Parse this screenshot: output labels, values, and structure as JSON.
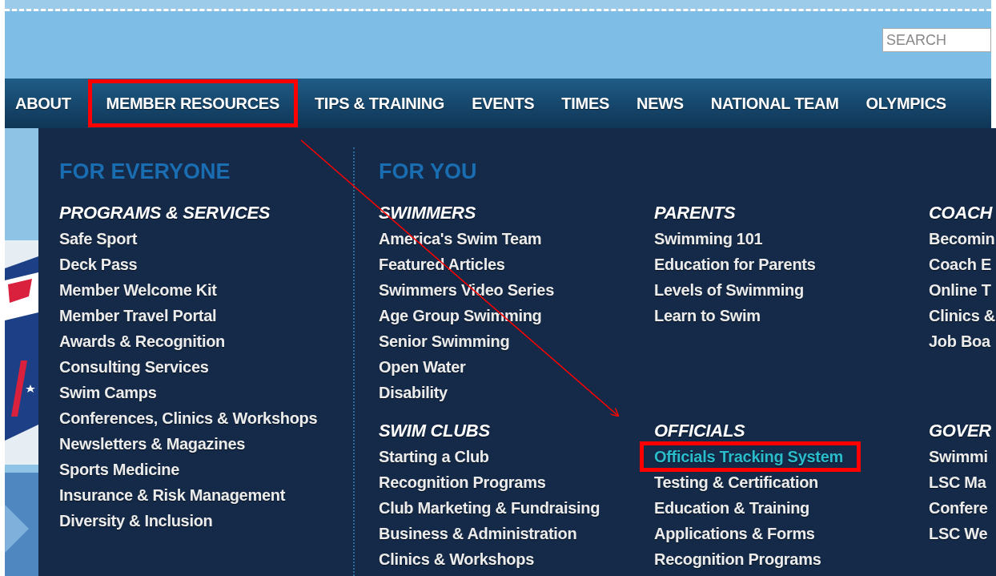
{
  "search": {
    "placeholder": "SEARCH"
  },
  "nav": [
    {
      "label": "ABOUT",
      "annotated": false
    },
    {
      "label": "MEMBER RESOURCES",
      "annotated": true
    },
    {
      "label": "TIPS & TRAINING",
      "annotated": false
    },
    {
      "label": "EVENTS",
      "annotated": false
    },
    {
      "label": "TIMES",
      "annotated": false
    },
    {
      "label": "NEWS",
      "annotated": false
    },
    {
      "label": "NATIONAL TEAM",
      "annotated": false
    },
    {
      "label": "OLYMPICS",
      "annotated": false
    }
  ],
  "menu": {
    "for_everyone": {
      "heading": "FOR EVERYONE",
      "sections": [
        {
          "heading": "PROGRAMS & SERVICES",
          "links": [
            {
              "label": "Safe Sport",
              "highlighted": false
            },
            {
              "label": "Deck Pass",
              "highlighted": false
            },
            {
              "label": "Member Welcome Kit",
              "highlighted": false
            },
            {
              "label": "Member Travel Portal",
              "highlighted": false
            },
            {
              "label": "Awards & Recognition",
              "highlighted": false
            },
            {
              "label": "Consulting Services",
              "highlighted": false
            },
            {
              "label": "Swim Camps",
              "highlighted": false
            },
            {
              "label": "Conferences, Clinics & Workshops",
              "highlighted": false
            },
            {
              "label": "Newsletters & Magazines",
              "highlighted": false
            },
            {
              "label": "Sports Medicine",
              "highlighted": false
            },
            {
              "label": "Insurance & Risk Management",
              "highlighted": false
            },
            {
              "label": "Diversity & Inclusion",
              "highlighted": false
            }
          ]
        }
      ]
    },
    "for_you": {
      "heading": "FOR YOU",
      "columns": [
        [
          {
            "heading": "SWIMMERS",
            "links": [
              {
                "label": "America's Swim Team",
                "highlighted": false
              },
              {
                "label": "Featured Articles",
                "highlighted": false
              },
              {
                "label": "Swimmers Video Series",
                "highlighted": false
              },
              {
                "label": "Age Group Swimming",
                "highlighted": false
              },
              {
                "label": "Senior Swimming",
                "highlighted": false
              },
              {
                "label": "Open Water",
                "highlighted": false
              },
              {
                "label": "Disability",
                "highlighted": false
              }
            ]
          },
          {
            "heading": "SWIM CLUBS",
            "links": [
              {
                "label": "Starting a Club",
                "highlighted": false
              },
              {
                "label": "Recognition Programs",
                "highlighted": false
              },
              {
                "label": "Club Marketing & Fundraising",
                "highlighted": false
              },
              {
                "label": "Business & Administration",
                "highlighted": false
              },
              {
                "label": "Clinics & Workshops",
                "highlighted": false
              }
            ]
          }
        ],
        [
          {
            "heading": "PARENTS",
            "links": [
              {
                "label": "Swimming 101",
                "highlighted": false
              },
              {
                "label": "Education for Parents",
                "highlighted": false
              },
              {
                "label": "Levels of Swimming",
                "highlighted": false
              },
              {
                "label": "Learn to Swim",
                "highlighted": false
              }
            ]
          },
          {
            "heading": "OFFICIALS",
            "links": [
              {
                "label": "Officials Tracking System",
                "highlighted": true
              },
              {
                "label": "Testing & Certification",
                "highlighted": false
              },
              {
                "label": "Education & Training",
                "highlighted": false
              },
              {
                "label": "Applications & Forms",
                "highlighted": false
              },
              {
                "label": "Recognition Programs",
                "highlighted": false
              }
            ]
          }
        ],
        [
          {
            "heading": "COACH",
            "links": [
              {
                "label": "Becomin",
                "highlighted": false
              },
              {
                "label": "Coach E",
                "highlighted": false
              },
              {
                "label": "Online T",
                "highlighted": false
              },
              {
                "label": "Clinics &",
                "highlighted": false
              },
              {
                "label": "Job Boa",
                "highlighted": false
              }
            ]
          },
          {
            "heading": "GOVER",
            "links": [
              {
                "label": "Swimmi",
                "highlighted": false
              },
              {
                "label": "LSC Ma",
                "highlighted": false
              },
              {
                "label": "Confere",
                "highlighted": false
              },
              {
                "label": "LSC We",
                "highlighted": false
              }
            ]
          }
        ]
      ]
    }
  }
}
